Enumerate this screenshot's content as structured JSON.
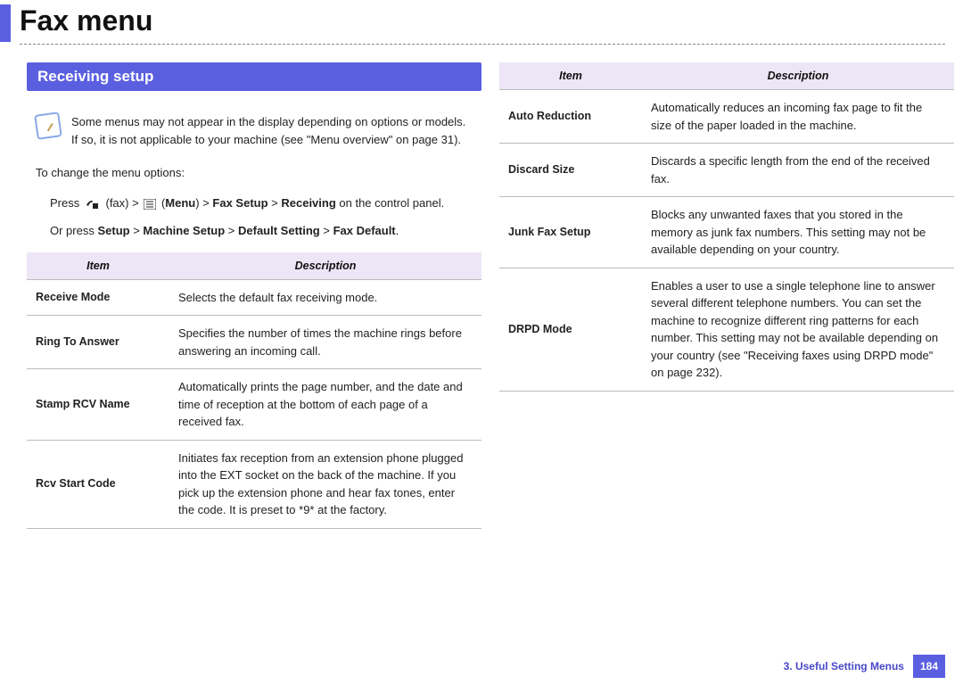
{
  "title": "Fax menu",
  "section_heading": "Receiving setup",
  "note": "Some menus may not appear in the display depending on options or models. If so, it is not applicable to your machine (see \"Menu overview\" on page 31).",
  "intro": "To change the menu options:",
  "instructions": {
    "line1": {
      "press": "Press",
      "fax_text": " (fax) >",
      "menu_text": " (",
      "menu_label": "Menu",
      "seq": ") > ",
      "fax_setup": "Fax Setup",
      "gt1": " > ",
      "receiving": "Receiving",
      "tail": " on the control panel."
    },
    "line2": {
      "orpress": "Or press ",
      "setup": "Setup",
      "gt1": " > ",
      "machine": "Machine Setup",
      "gt2": " > ",
      "default": "Default Setting",
      "gt3": " > ",
      "faxdef": "Fax Default",
      "tail": "."
    }
  },
  "headers": {
    "item": "Item",
    "desc": "Description"
  },
  "table1": [
    {
      "label": "Receive Mode",
      "desc": "Selects the default fax receiving mode."
    },
    {
      "label": "Ring To Answer",
      "desc": "Specifies the number of times the machine rings before answering an incoming call."
    },
    {
      "label": "Stamp RCV Name",
      "desc": "Automatically prints the page number, and the date and time of reception at the bottom of each page of a received fax."
    },
    {
      "label": "Rcv Start Code",
      "desc": "Initiates fax reception from an extension phone plugged into the EXT socket on the back of the machine. If you pick up the extension phone and hear fax tones, enter the code. It is preset to *9* at the factory."
    }
  ],
  "table2": [
    {
      "label": "Auto Reduction",
      "desc": "Automatically reduces an incoming fax page to fit the size of the paper loaded in the machine."
    },
    {
      "label": "Discard Size",
      "desc": "Discards a specific length from the end of the received fax."
    },
    {
      "label": "Junk Fax Setup",
      "desc": "Blocks any unwanted faxes that you stored in the memory as junk fax numbers. This setting may not be available depending on your country."
    },
    {
      "label": "DRPD Mode",
      "desc": "Enables a user to use a single telephone line to answer several different telephone numbers. You can set the machine to recognize different ring patterns for each number. This setting may not be available depending on your country (see \"Receiving faxes using DRPD mode\" on page 232)."
    }
  ],
  "footer": {
    "chapter": "3.  Useful Setting Menus",
    "page": "184"
  }
}
